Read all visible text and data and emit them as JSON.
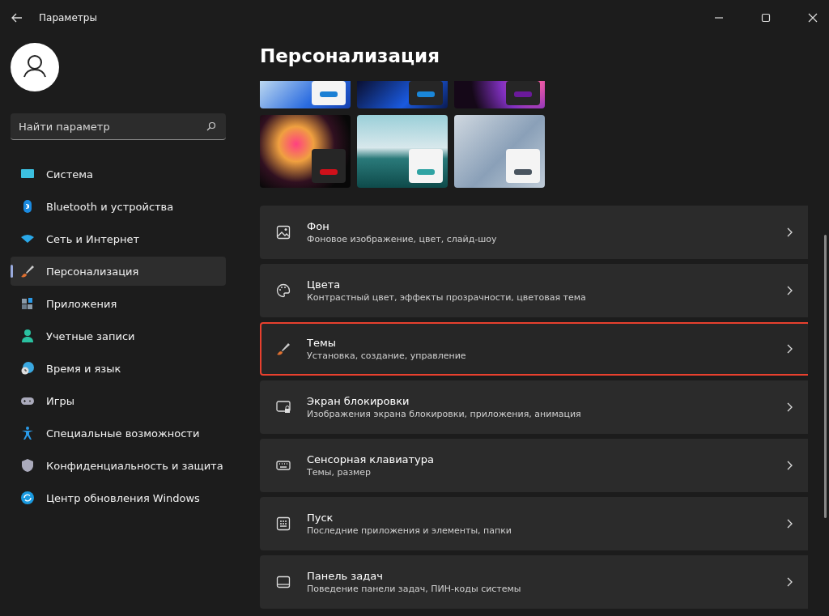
{
  "window": {
    "title": "Параметры"
  },
  "search": {
    "placeholder": "Найти параметр"
  },
  "sidebar": {
    "items": [
      {
        "label": "Система",
        "selected": false
      },
      {
        "label": "Bluetooth и устройства",
        "selected": false
      },
      {
        "label": "Сеть и Интернет",
        "selected": false
      },
      {
        "label": "Персонализация",
        "selected": true
      },
      {
        "label": "Приложения",
        "selected": false
      },
      {
        "label": "Учетные записи",
        "selected": false
      },
      {
        "label": "Время и язык",
        "selected": false
      },
      {
        "label": "Игры",
        "selected": false
      },
      {
        "label": "Специальные возможности",
        "selected": false
      },
      {
        "label": "Конфиденциальность и защита",
        "selected": false
      },
      {
        "label": "Центр обновления Windows",
        "selected": false
      }
    ]
  },
  "page_title": "Персонализация",
  "themes": [
    {
      "kind": "light",
      "color": "#1a7fd4"
    },
    {
      "kind": "dark",
      "color": "#1a86d8"
    },
    {
      "kind": "dark",
      "color": "#6a1a9a"
    },
    {
      "kind": "dark",
      "color": "#d0101a"
    },
    {
      "kind": "light",
      "color": "#2fa3a3"
    },
    {
      "kind": "light",
      "color": "#4a5560"
    }
  ],
  "settings": [
    {
      "title": "Фон",
      "subtitle": "Фоновое изображение, цвет, слайд-шоу",
      "highlighted": false
    },
    {
      "title": "Цвета",
      "subtitle": "Контрастный цвет, эффекты прозрачности, цветовая тема",
      "highlighted": false
    },
    {
      "title": "Темы",
      "subtitle": "Установка, создание, управление",
      "highlighted": true
    },
    {
      "title": "Экран блокировки",
      "subtitle": "Изображения экрана блокировки, приложения, анимация",
      "highlighted": false
    },
    {
      "title": "Сенсорная клавиатура",
      "subtitle": "Темы, размер",
      "highlighted": false
    },
    {
      "title": "Пуск",
      "subtitle": "Последние приложения и элементы, папки",
      "highlighted": false
    },
    {
      "title": "Панель задач",
      "subtitle": "Поведение панели задач, ПИН-коды системы",
      "highlighted": false
    }
  ]
}
